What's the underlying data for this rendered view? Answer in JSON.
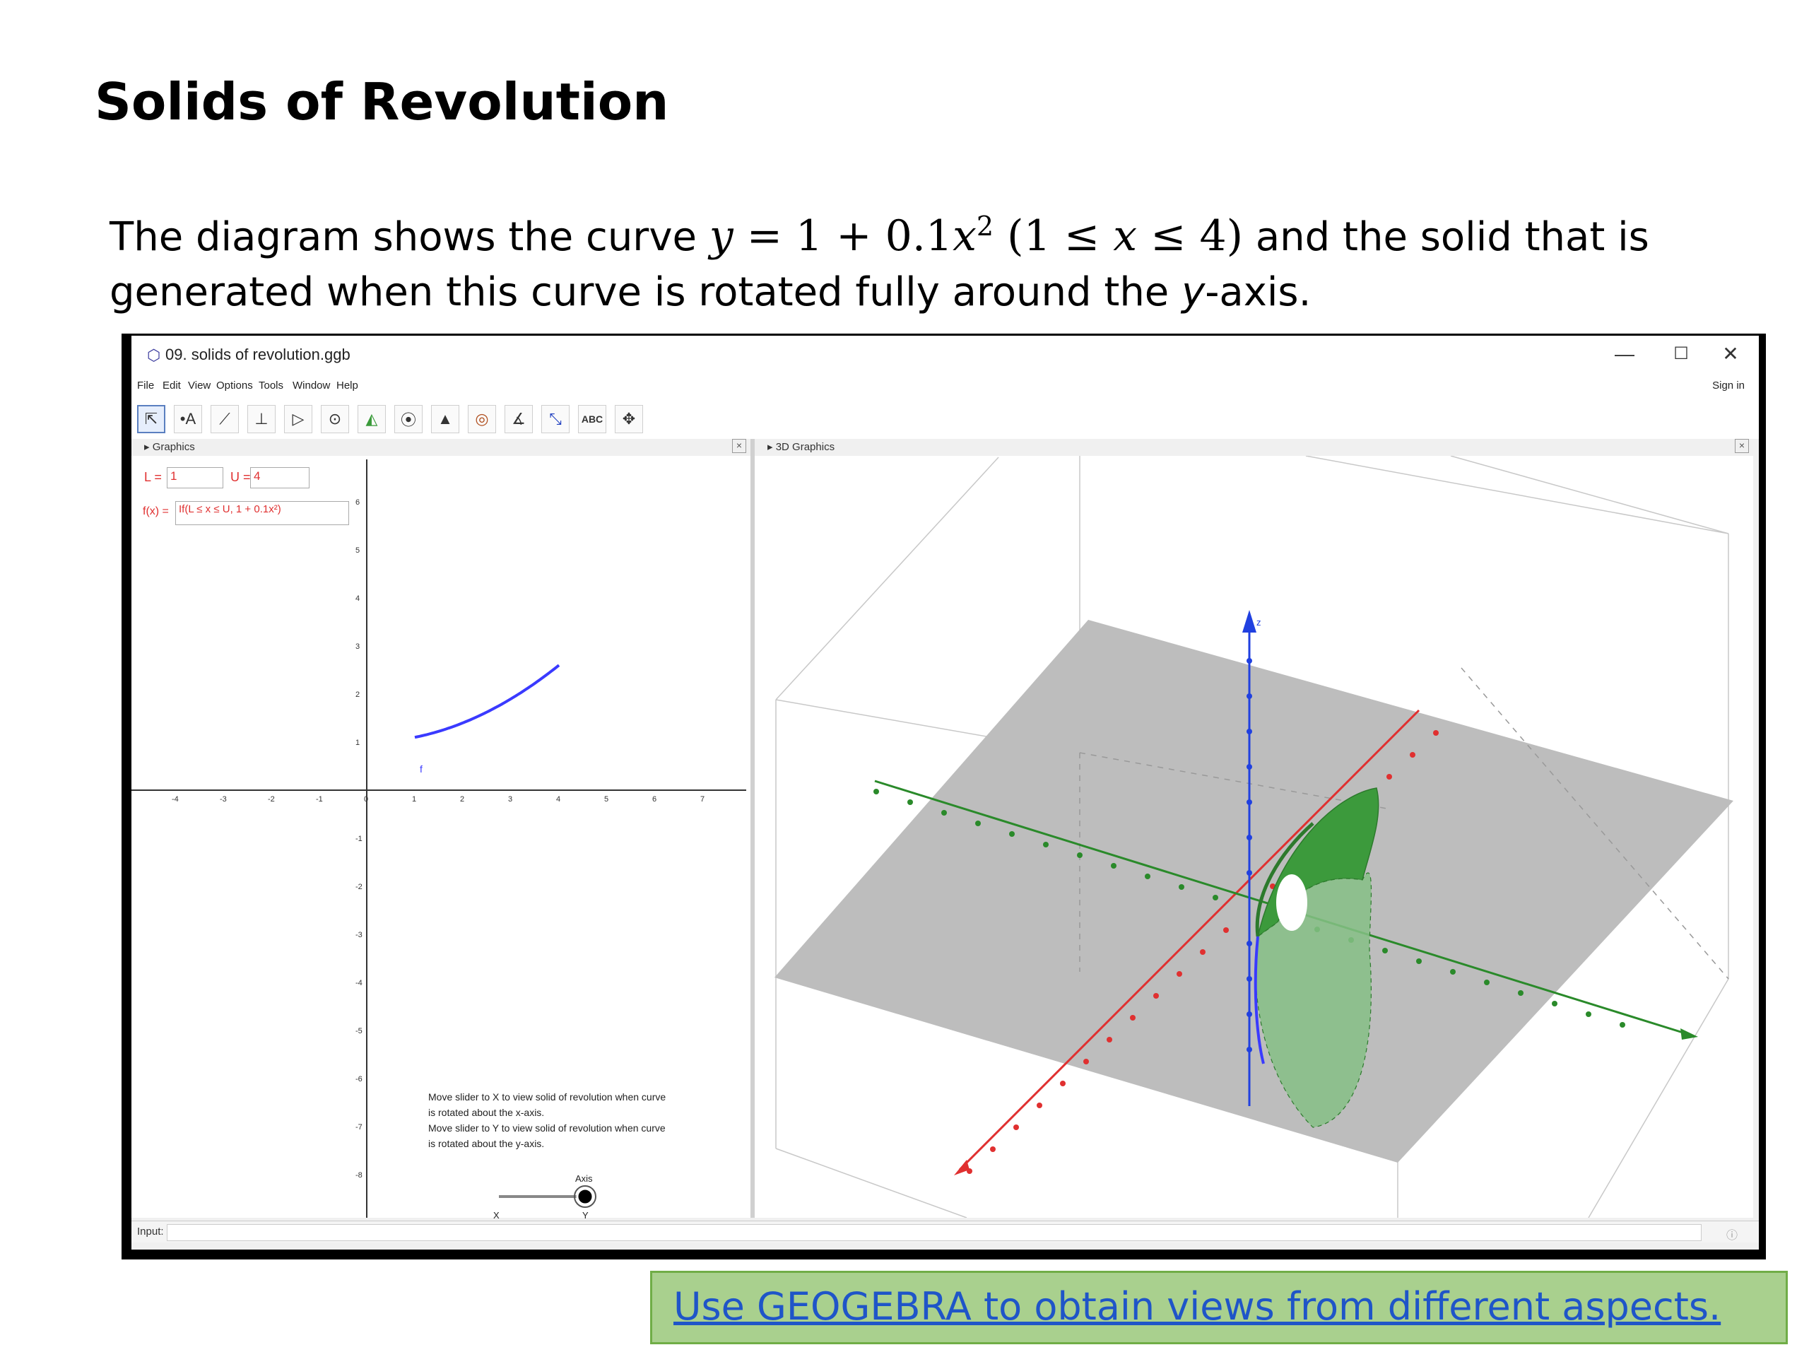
{
  "slide": {
    "title": "Solids of Revolution",
    "text_before": "The diagram shows the curve ",
    "math_y": "y",
    "math_eq1": " = 1 + 0.1",
    "math_x": "x",
    "math_sup": "2",
    "math_open": "  (1 ≤ ",
    "math_x2": "x",
    "math_close": " ≤ 4)",
    "text_after": " and the solid that is generated when this curve is rotated fully around the ",
    "y_axis_letter": "y",
    "text_end": "-axis."
  },
  "window": {
    "title": "09. solids of revolution.ggb",
    "minimize": "—",
    "maximize": "☐",
    "close": "✕",
    "menu": [
      "File",
      "Edit",
      "View",
      "Options",
      "Tools",
      "Window",
      "Help"
    ],
    "sign_in": "Sign in",
    "tools": [
      "⇱",
      "•A",
      "⟋",
      "⊥",
      "▷",
      "⊙",
      "◭",
      "⦿",
      "▲",
      "◎",
      "∡",
      "⤡",
      "ABC",
      "✥"
    ],
    "panel_2d": "Graphics",
    "panel_3d": "3D Graphics",
    "panel_close": "×",
    "input_label": "Input:"
  },
  "algebra": {
    "L_label": "L =",
    "L_value": "1",
    "U_label": "U =",
    "U_value": "4",
    "f_label": "f(x) =",
    "f_value": "If(L ≤ x ≤ U, 1 + 0.1x²)"
  },
  "graph2d": {
    "x_ticks": [
      "-4",
      "-3",
      "-2",
      "-1",
      "0",
      "1",
      "2",
      "3",
      "4",
      "5",
      "6",
      "7"
    ],
    "y_ticks": [
      "6",
      "5",
      "4",
      "3",
      "2",
      "1",
      "-1",
      "-2",
      "-3",
      "-4",
      "-5",
      "-6",
      "-7",
      "-8"
    ],
    "curve_label": "f",
    "curve": {
      "function": "1 + 0.1x²",
      "x_min": 1,
      "x_max": 4,
      "color": "#3a3aff"
    },
    "note_lines": [
      "Move slider to X to view solid of revolution when curve",
      "is rotated about the x-axis.",
      "Move slider to Y to view solid of revolution when curve",
      "is rotated about the y-axis."
    ],
    "slider_label": "Axis",
    "slider_left": "X",
    "slider_right": "Y",
    "slider_value": "Y"
  },
  "graph3d": {
    "z_label": "z",
    "solid_color": "#3c9a3c",
    "axis_colors": {
      "x": "#e03030",
      "y": "#2a8a2a",
      "z": "#2040e0"
    }
  },
  "cta": {
    "text": "Use GEOGEBRA to obtain views from different aspects."
  }
}
